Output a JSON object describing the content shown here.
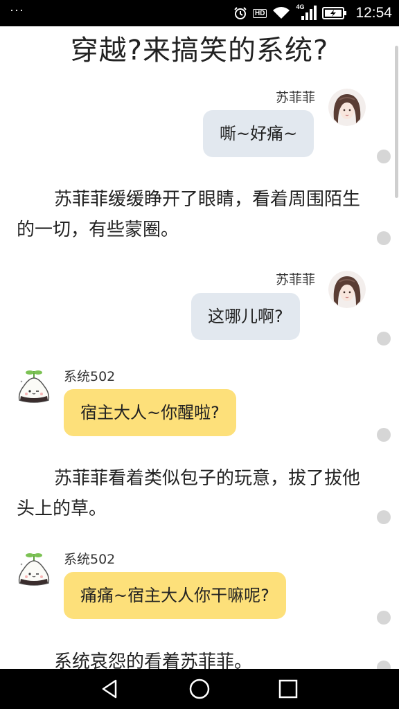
{
  "status_bar": {
    "menu_dots": "···",
    "hd_label": "HD",
    "network_label": "4G",
    "time": "12:54"
  },
  "story": {
    "title": "穿越?来搞笑的系统?"
  },
  "messages": [
    {
      "type": "chat",
      "side": "right",
      "speaker": "苏菲菲",
      "text": "嘶~好痛~"
    },
    {
      "type": "narration",
      "text": "苏菲菲缓缓睁开了眼睛，看着周围陌生的一切，有些蒙圈。"
    },
    {
      "type": "chat",
      "side": "right",
      "speaker": "苏菲菲",
      "text": "这哪儿啊?"
    },
    {
      "type": "chat",
      "side": "left",
      "speaker": "系统502",
      "text": "宿主大人~你醒啦?"
    },
    {
      "type": "narration",
      "text": "苏菲菲看着类似包子的玩意，拔了拔他头上的草。"
    },
    {
      "type": "chat",
      "side": "left",
      "speaker": "系统502",
      "text": "痛痛~宿主大人你干嘛呢?"
    },
    {
      "type": "narration",
      "text": "系统哀怨的看着苏菲菲。"
    }
  ],
  "colors": {
    "user_bubble": "#e2e8ef",
    "system_bubble": "#fde07a",
    "status_bar": "#000000",
    "nav_bar": "#000000"
  },
  "icons": {
    "avatar_user": "girl-avatar-icon",
    "avatar_system": "rice-ball-avatar-icon",
    "nav_back": "triangle-back-icon",
    "nav_home": "circle-home-icon",
    "nav_recents": "square-recents-icon"
  }
}
